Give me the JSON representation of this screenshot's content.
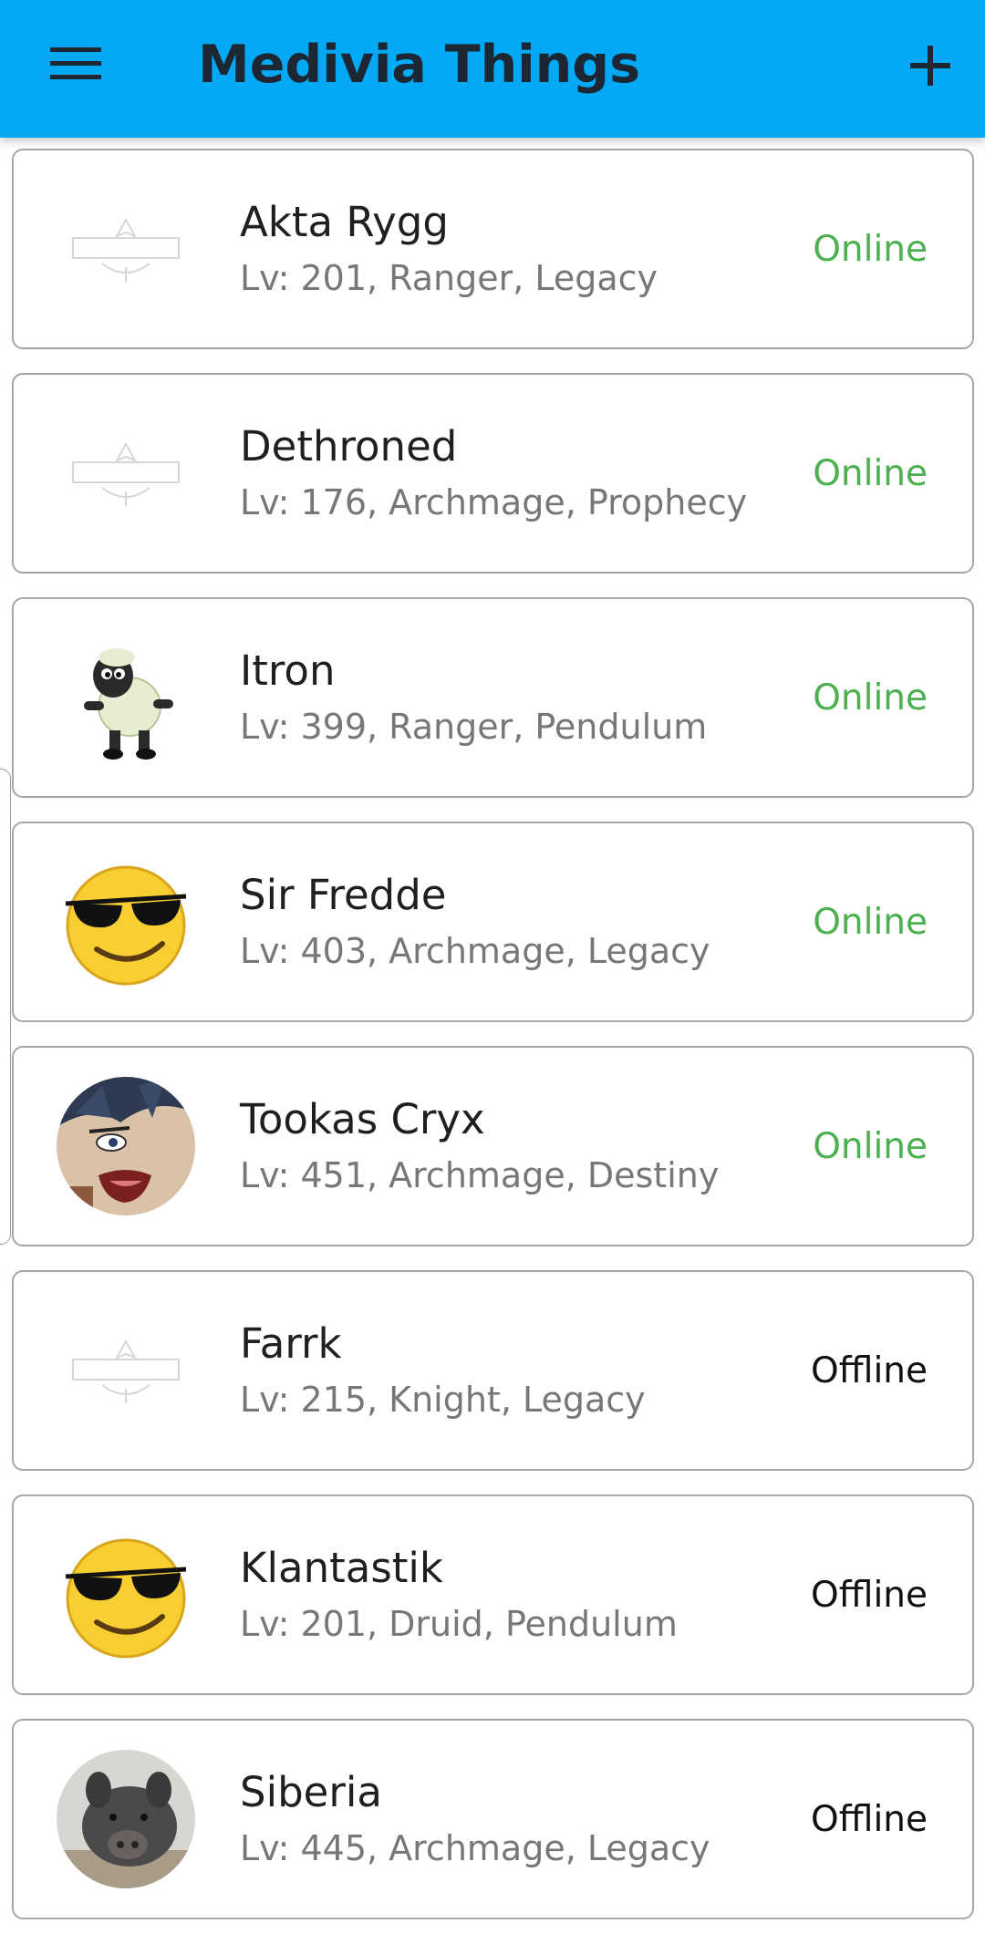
{
  "app": {
    "title": "Medivia Things",
    "menu_icon": "hamburger-menu-icon",
    "add_icon": "plus-icon"
  },
  "colors": {
    "appbar": "#03a9f4",
    "online": "#4caf50",
    "offline": "#111111"
  },
  "characters": [
    {
      "name": "Akta Rygg",
      "detail": "Lv: 201, Ranger, Legacy",
      "status": "Online",
      "avatar": "medivia-logo"
    },
    {
      "name": "Dethroned",
      "detail": "Lv: 176, Archmage, Prophecy",
      "status": "Online",
      "avatar": "medivia-logo"
    },
    {
      "name": "Itron",
      "detail": "Lv: 399, Ranger, Pendulum",
      "status": "Online",
      "avatar": "sheep-plush"
    },
    {
      "name": "Sir Fredde",
      "detail": "Lv: 403, Archmage, Legacy",
      "status": "Online",
      "avatar": "sunglasses-smiley"
    },
    {
      "name": "Tookas Cryx",
      "detail": "Lv: 451, Archmage, Destiny",
      "status": "Online",
      "avatar": "anime-face"
    },
    {
      "name": "Farrk",
      "detail": "Lv: 215, Knight, Legacy",
      "status": "Offline",
      "avatar": "medivia-logo"
    },
    {
      "name": "Klantastik",
      "detail": "Lv: 201, Druid, Pendulum",
      "status": "Offline",
      "avatar": "sunglasses-smiley"
    },
    {
      "name": "Siberia",
      "detail": "Lv: 445, Archmage, Legacy",
      "status": "Offline",
      "avatar": "boar-photo"
    }
  ]
}
